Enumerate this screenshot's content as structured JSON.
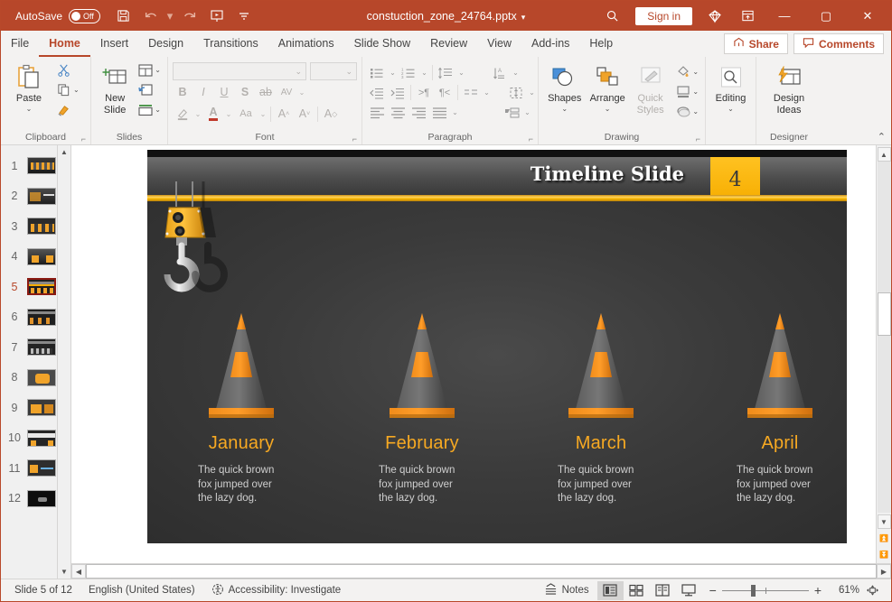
{
  "titlebar": {
    "autosave_label": "AutoSave",
    "autosave_state": "Off",
    "save_icon": "save-icon",
    "undo_icon": "undo-icon",
    "redo_icon": "redo-icon",
    "present_icon": "start-presentation-icon",
    "customize_icon": "customize-quick-access-icon",
    "document_title": "constuction_zone_24764.pptx",
    "title_caret": "▾",
    "search_icon": "search-icon",
    "signin_label": "Sign in",
    "diamond_icon": "microsoft-365-diamond-icon",
    "ribbon_options_icon": "ribbon-display-options-icon",
    "minimize_label": "—",
    "maximize_label": "▢",
    "close_label": "✕"
  },
  "tabs": [
    {
      "label": "File",
      "active": false
    },
    {
      "label": "Home",
      "active": true
    },
    {
      "label": "Insert",
      "active": false
    },
    {
      "label": "Design",
      "active": false
    },
    {
      "label": "Transitions",
      "active": false
    },
    {
      "label": "Animations",
      "active": false
    },
    {
      "label": "Slide Show",
      "active": false
    },
    {
      "label": "Review",
      "active": false
    },
    {
      "label": "View",
      "active": false
    },
    {
      "label": "Add-ins",
      "active": false
    },
    {
      "label": "Help",
      "active": false
    }
  ],
  "tabbar_right": {
    "share_label": "Share",
    "share_icon": "share-icon",
    "comments_label": "Comments",
    "comments_icon": "comment-icon"
  },
  "ribbon": {
    "clipboard": {
      "group_label": "Clipboard",
      "paste_label": "Paste",
      "paste_icon": "paste-icon",
      "cut_icon": "scissors-icon",
      "copy_icon": "copy-icon",
      "format_painter_icon": "format-painter-icon",
      "launcher_icon": "dialog-launcher-icon"
    },
    "slides": {
      "group_label": "Slides",
      "new_slide_label": "New Slide",
      "new_slide_icon": "new-slide-icon",
      "layout_icon": "layout-icon",
      "reset_icon": "reset-icon",
      "section_icon": "section-icon"
    },
    "font": {
      "group_label": "Font",
      "font_name_value": "",
      "font_size_value": "",
      "bold_label": "B",
      "italic_label": "I",
      "underline_label": "U",
      "shadow_label": "S",
      "strikethrough_label": "ab",
      "char_spacing_label": "AV",
      "text_highlight_icon": "text-highlight-icon",
      "font_color_label": "A",
      "change_case_label": "Aa",
      "increase_size_label": "A",
      "decrease_size_label": "A",
      "clear_format_label": "A",
      "launcher_icon": "dialog-launcher-icon"
    },
    "paragraph": {
      "group_label": "Paragraph",
      "bullets_icon": "bullets-icon",
      "numbering_icon": "numbering-icon",
      "line_spacing_icon": "line-spacing-icon",
      "text_direction_icon": "text-direction-icon",
      "decrease_indent_icon": "decrease-indent-icon",
      "increase_indent_icon": "increase-indent-icon",
      "ltr_icon": "left-to-right-icon",
      "rtl_icon": "right-to-left-icon",
      "columns_icon": "columns-icon",
      "align_text_icon": "align-text-icon",
      "align_left_icon": "align-left-icon",
      "align_center_icon": "align-center-icon",
      "align_right_icon": "align-right-icon",
      "justify_icon": "justify-icon",
      "smartart_icon": "convert-to-smartart-icon",
      "launcher_icon": "dialog-launcher-icon"
    },
    "drawing": {
      "group_label": "Drawing",
      "shapes_label": "Shapes",
      "shapes_icon": "shapes-icon",
      "arrange_label": "Arrange",
      "arrange_icon": "arrange-icon",
      "quick_styles_label": "Quick Styles",
      "quick_styles_icon": "quick-styles-icon",
      "shape_fill_icon": "shape-fill-icon",
      "shape_outline_icon": "shape-outline-icon",
      "shape_effects_icon": "shape-effects-icon",
      "launcher_icon": "dialog-launcher-icon"
    },
    "editing": {
      "editing_label": "Editing",
      "editing_icon": "find-magnifier-icon"
    },
    "designer": {
      "group_label": "Designer",
      "design_ideas_label": "Design Ideas",
      "design_ideas_icon": "design-ideas-icon"
    },
    "collapse_icon": "collapse-ribbon-icon"
  },
  "thumbnails": {
    "selected": 5,
    "slides": [
      {
        "num": "1"
      },
      {
        "num": "2"
      },
      {
        "num": "3"
      },
      {
        "num": "4"
      },
      {
        "num": "5"
      },
      {
        "num": "6"
      },
      {
        "num": "7"
      },
      {
        "num": "8"
      },
      {
        "num": "9"
      },
      {
        "num": "10"
      },
      {
        "num": "11"
      },
      {
        "num": "12"
      }
    ],
    "scroll_up_icon": "scroll-up-icon",
    "scroll_down_icon": "scroll-down-icon"
  },
  "slide": {
    "title": "Timeline Slide",
    "number_badge": "4",
    "hook_icon": "crane-hook-icon",
    "columns": [
      {
        "month": "January",
        "text": "The quick brown fox jumped over the lazy dog.",
        "cone_icon": "traffic-cone-icon"
      },
      {
        "month": "February",
        "text": "The quick brown fox jumped over the lazy dog.",
        "cone_icon": "traffic-cone-icon"
      },
      {
        "month": "March",
        "text": "The quick brown fox jumped over the lazy dog.",
        "cone_icon": "traffic-cone-icon"
      },
      {
        "month": "April",
        "text": "The quick brown fox jumped over the lazy dog.",
        "cone_icon": "traffic-cone-icon"
      }
    ],
    "colors": {
      "accent_gold": "#f6ad00",
      "month_text": "#f7a922",
      "body_text": "#cfcfcf",
      "background": "#3b3b3b"
    }
  },
  "scrollbars": {
    "v_up_icon": "scroll-up-icon",
    "v_down_icon": "scroll-down-icon",
    "prev_slide_icon": "previous-slide-icon",
    "next_slide_icon": "next-slide-icon",
    "h_left_icon": "scroll-left-icon",
    "h_right_icon": "scroll-right-icon"
  },
  "statusbar": {
    "slide_position": "Slide 5 of 12",
    "language": "English (United States)",
    "accessibility_label": "Accessibility: Investigate",
    "accessibility_icon": "accessibility-icon",
    "notes_label": "Notes",
    "notes_icon": "notes-icon",
    "view_normal_icon": "normal-view-icon",
    "view_sorter_icon": "slide-sorter-icon",
    "view_reading_icon": "reading-view-icon",
    "view_slideshow_icon": "slide-show-icon",
    "zoom_out_label": "−",
    "zoom_in_label": "+",
    "zoom_level": "61%",
    "fit_window_icon": "fit-to-window-icon"
  }
}
